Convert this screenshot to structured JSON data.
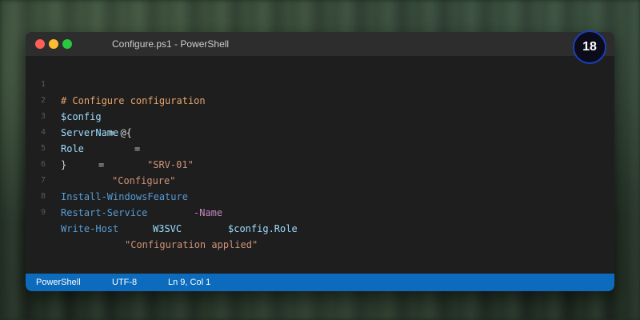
{
  "window": {
    "title": "Configure.ps1 - PowerShell",
    "badge": "18"
  },
  "editor": {
    "lines": [
      {
        "number": "1",
        "tokens": [
          "# Configure configuration"
        ]
      },
      {
        "number": "2",
        "tokens": [
          "$config",
          "= @{"
        ]
      },
      {
        "number": "3",
        "tokens": [
          "ServerName",
          "= ",
          "\"SRV-01\""
        ]
      },
      {
        "number": "4",
        "tokens": [
          "Role",
          "= ",
          "\"Configure\""
        ]
      },
      {
        "number": "5",
        "tokens": [
          "}"
        ]
      },
      {
        "number": "6",
        "tokens": []
      },
      {
        "number": "7",
        "tokens": [
          "Install-WindowsFeature",
          "-Name",
          "$config.Role"
        ]
      },
      {
        "number": "8",
        "tokens": [
          "Restart-Service",
          "W3SVC"
        ]
      },
      {
        "number": "9",
        "tokens": [
          "Write-Host",
          "\"Configuration applied\""
        ]
      }
    ]
  },
  "statusbar": {
    "language": "PowerShell",
    "encoding": "UTF-8",
    "cursor": "Ln 9, Col 1"
  },
  "colors": {
    "statusbar": "#0d6bbd",
    "editor_bg": "#1e1e1e",
    "titlebar_bg": "#2d2d2d",
    "badge_ring": "#1a3fb8",
    "comment": "#e8a46a",
    "variable": "#9cdcfe",
    "string": "#ce9178",
    "command": "#569cd6",
    "parameter": "#c586c0"
  }
}
